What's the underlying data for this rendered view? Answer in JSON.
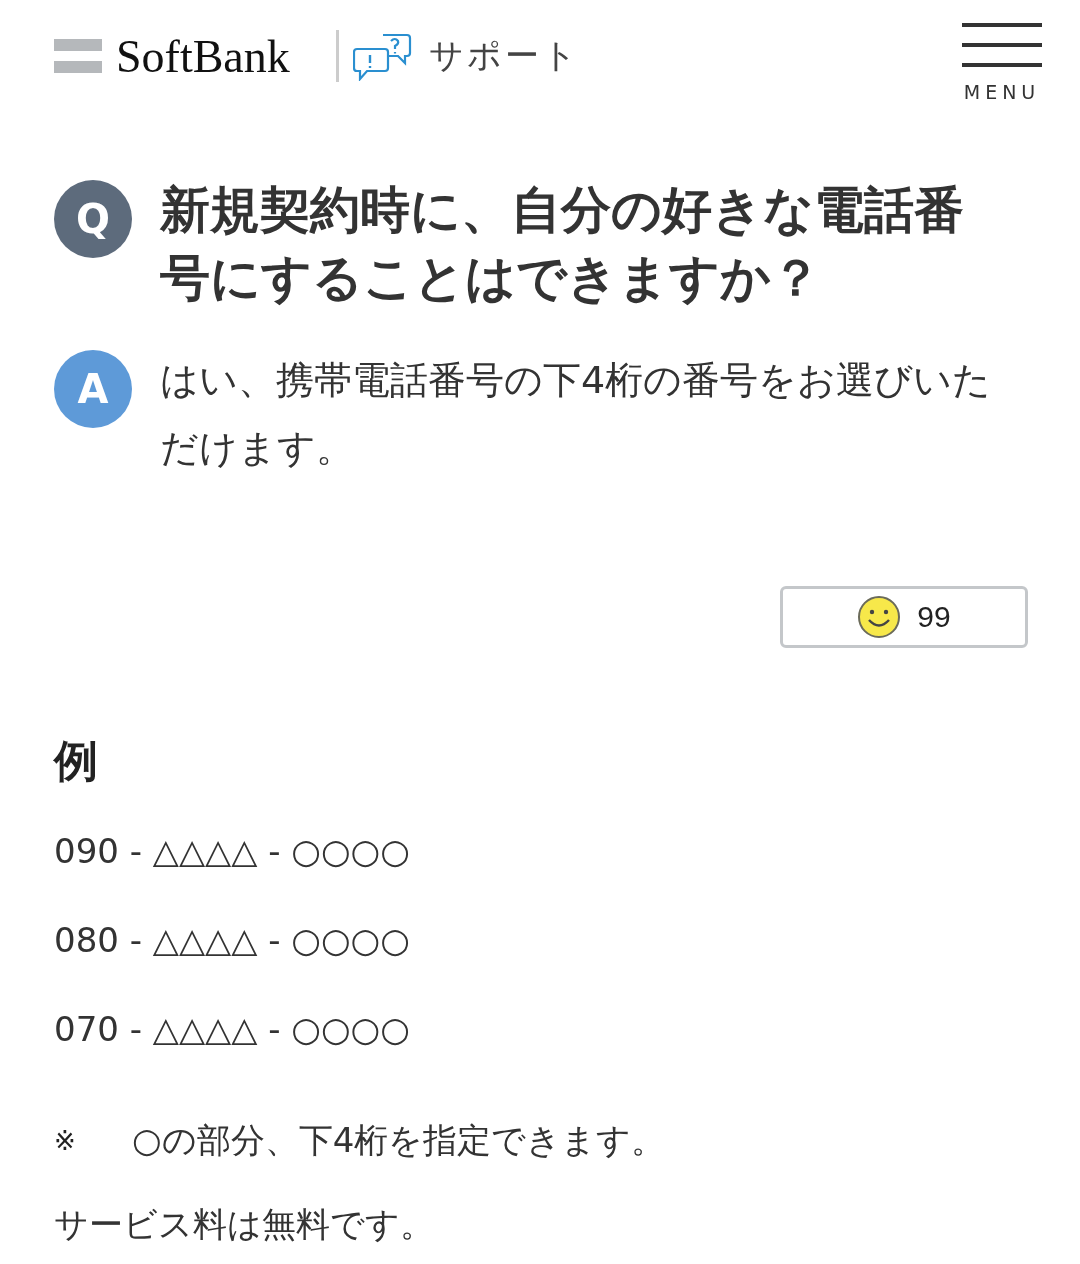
{
  "header": {
    "logo": "SoftBank",
    "section": "サポート",
    "menu_label": "MENU"
  },
  "question": {
    "badge": "Q",
    "text": "新規契約時に、自分の好きな電話番号にすることはできますか？"
  },
  "answer": {
    "badge": "A",
    "text": "はい、携帯電話番号の下4桁の番号をお選びいただけます。"
  },
  "reaction": {
    "count": "99"
  },
  "example": {
    "heading": "例",
    "lines": [
      "090 - △△△△ - ○○○○",
      "080 - △△△△ - ○○○○",
      "070 - △△△△ - ○○○○"
    ],
    "note_mark": "※",
    "note": "○の部分、下4桁を指定できます。",
    "footer_text": "サービス料は無料です。"
  }
}
